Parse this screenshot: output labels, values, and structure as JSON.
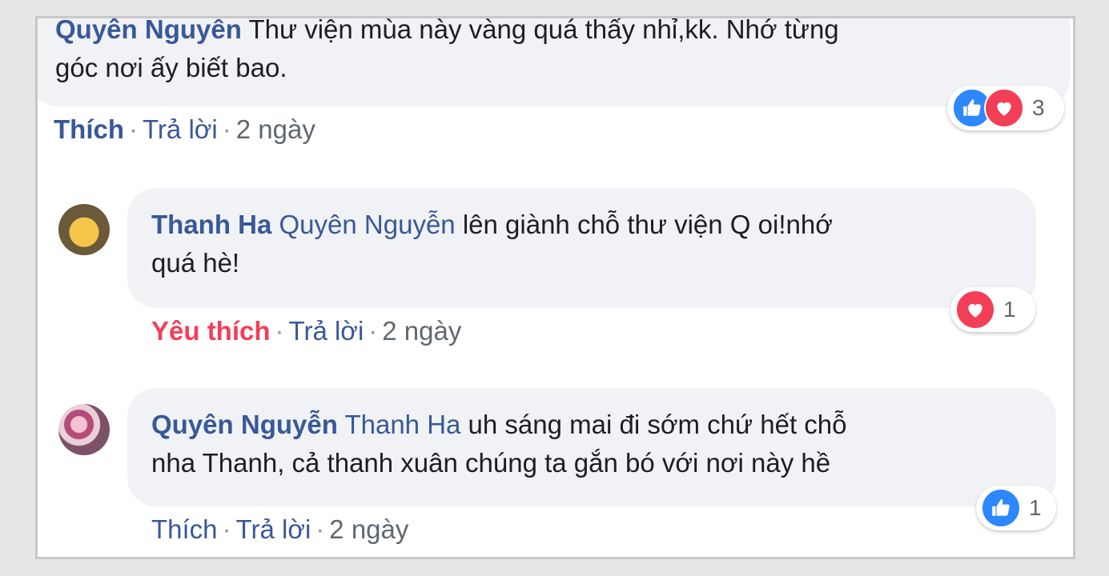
{
  "comments": [
    {
      "author": "Quyên Nguyễn",
      "line1": " Thư viện mùa này vàng quá thấy nhỉ,kk. Nhớ từng",
      "line2": "góc nơi ấy biết bao.",
      "action_like": "Thích",
      "action_reply": "Trả lời",
      "time": "2 ngày",
      "reaction_count": "3"
    },
    {
      "author": "Thanh Ha",
      "tag": "Quyên Nguyễn",
      "line1": " lên giành chỗ thư viện Q oi!nhớ",
      "line2": "quá hè!",
      "action_like": "Yêu thích",
      "action_reply": "Trả lời",
      "time": "2 ngày",
      "reaction_count": "1"
    },
    {
      "author": "Quyên Nguyễn",
      "tag": "Thanh Ha",
      "line1": " uh sáng mai đi sớm chứ hết chỗ",
      "line2": "nha Thanh, cả thanh xuân chúng ta gắn bó với nơi này hề",
      "action_like": "Thích",
      "action_reply": "Trả lời",
      "time": "2 ngày",
      "reaction_count": "1"
    }
  ],
  "separator": "·",
  "colors": {
    "link": "#385898",
    "love": "#f33e58",
    "like_icon": "#2d88ff",
    "bubble": "#f0f2f5"
  },
  "icons": [
    "like-icon",
    "love-icon"
  ]
}
